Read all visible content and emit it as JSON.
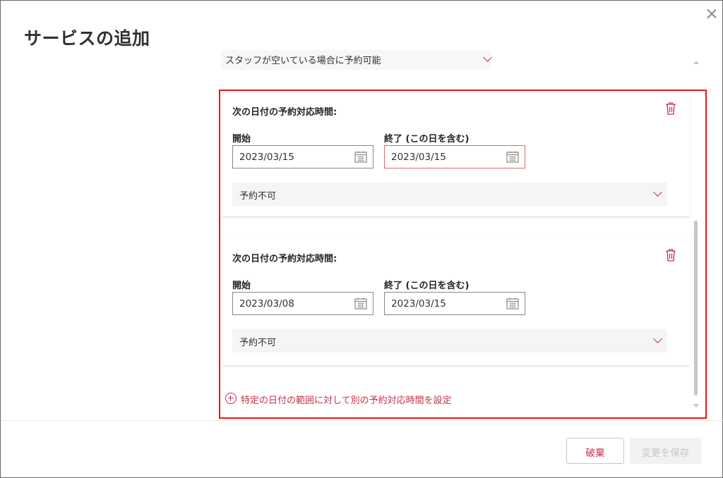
{
  "dialog": {
    "title": "サービスの追加"
  },
  "top_select": {
    "value": "スタッフが空いている場合に予約可能"
  },
  "cards": [
    {
      "title": "次の日付の予約対応時間:",
      "start_label": "開始",
      "start_value": "2023/03/15",
      "end_label": "終了 (この日を含む)",
      "end_value": "2023/03/15",
      "availability": "予約不可"
    },
    {
      "title": "次の日付の予約対応時間:",
      "start_label": "開始",
      "start_value": "2023/03/08",
      "end_label": "終了 (この日を含む)",
      "end_value": "2023/03/15",
      "availability": "予約不可"
    }
  ],
  "add_range_link": "特定の日付の範囲に対して別の予約対応時間を設定",
  "footer": {
    "discard_label": "破棄",
    "save_label": "変更を保存"
  },
  "colors": {
    "accent": "#c4314b",
    "highlight": "#e8141b",
    "error_border": "#e0686e"
  },
  "icons": [
    "close-icon",
    "chevron-down-icon",
    "trash-icon",
    "calendar-icon",
    "add-circle-icon"
  ]
}
